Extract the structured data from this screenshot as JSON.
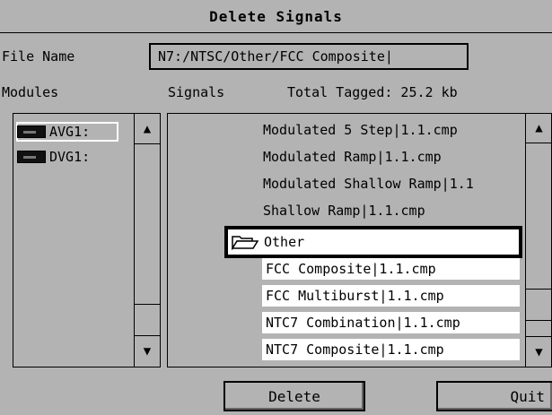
{
  "window": {
    "title": "Delete Signals"
  },
  "file": {
    "label": "File Name",
    "value": "N7:/NTSC/Other/FCC  Composite|"
  },
  "headers": {
    "modules": "Modules",
    "signals": "Signals",
    "total_tagged": "Total Tagged:  25.2 kb"
  },
  "modules": [
    {
      "label": "AVG1:",
      "icon": "module-icon"
    },
    {
      "label": "DVG1:",
      "icon": "module-icon"
    }
  ],
  "signals": [
    {
      "label": "Modulated  5 Step|1.1.cmp"
    },
    {
      "label": "Modulated  Ramp|1.1.cmp"
    },
    {
      "label": "Modulated  Shallow Ramp|1.1"
    },
    {
      "label": "Shallow  Ramp|1.1.cmp"
    }
  ],
  "folder": {
    "label": "Other",
    "icon": "folder-open-icon"
  },
  "tagged": [
    {
      "label": "FCC  Composite|1.1.cmp"
    },
    {
      "label": "FCC  Multiburst|1.1.cmp"
    },
    {
      "label": "NTC7  Combination|1.1.cmp"
    },
    {
      "label": "NTC7  Composite|1.1.cmp"
    }
  ],
  "scroll_arrows": {
    "up": "▲",
    "down": "▼"
  },
  "buttons": {
    "delete": "Delete",
    "quit": "Quit"
  }
}
